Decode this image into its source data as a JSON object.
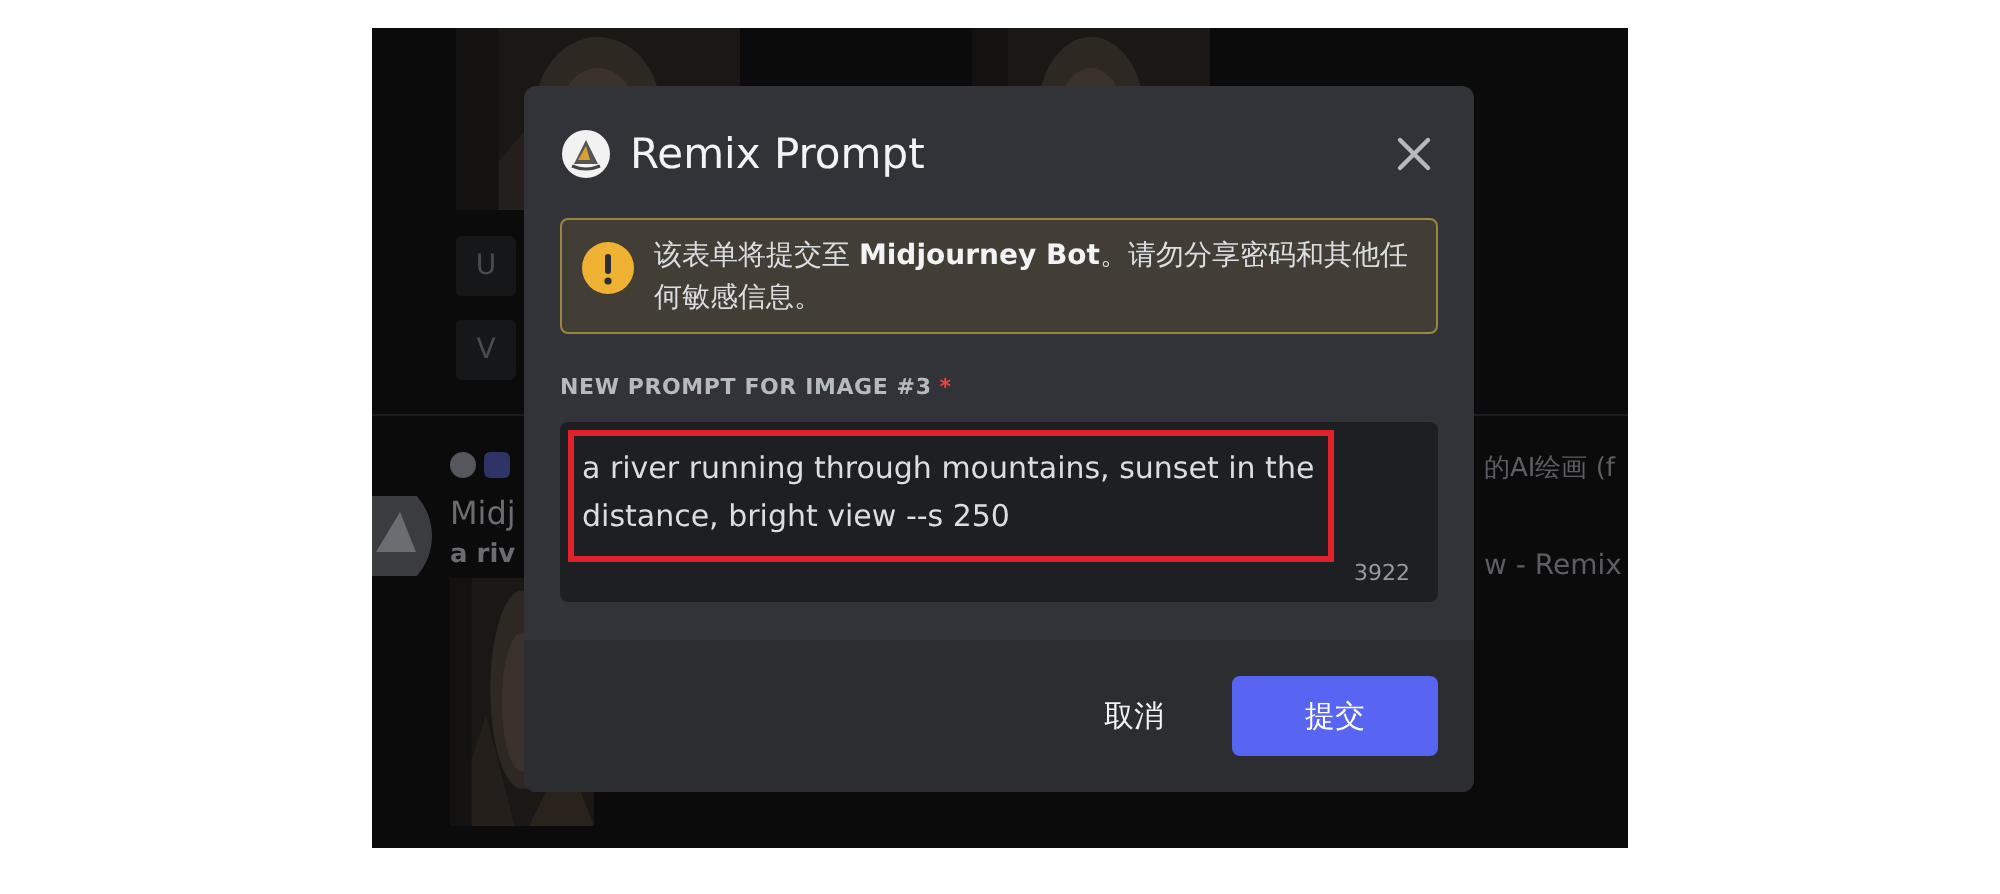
{
  "background": {
    "image_buttons": [
      {
        "label": "U"
      },
      {
        "label": "V"
      }
    ],
    "author_fragment": "Midj",
    "prompt_fragment": "a riv",
    "title_fragment": "的AI绘画 (f",
    "remix_fragment": "w - Remix"
  },
  "dialog": {
    "title": "Remix Prompt",
    "warning": "该表单将提交至 **Midjourney Bot**。请勿分享密码和其他任何敏感信息。",
    "field_label": "NEW PROMPT FOR IMAGE #3",
    "required_mark": "*",
    "prompt": {
      "value": "a river running through mountains, sunset in the distance, bright view --s 250",
      "counter": "3922",
      "highlighted": true
    },
    "buttons": [
      {
        "label": "取消",
        "kind": "link"
      },
      {
        "label": "提交",
        "kind": "primary"
      }
    ]
  }
}
